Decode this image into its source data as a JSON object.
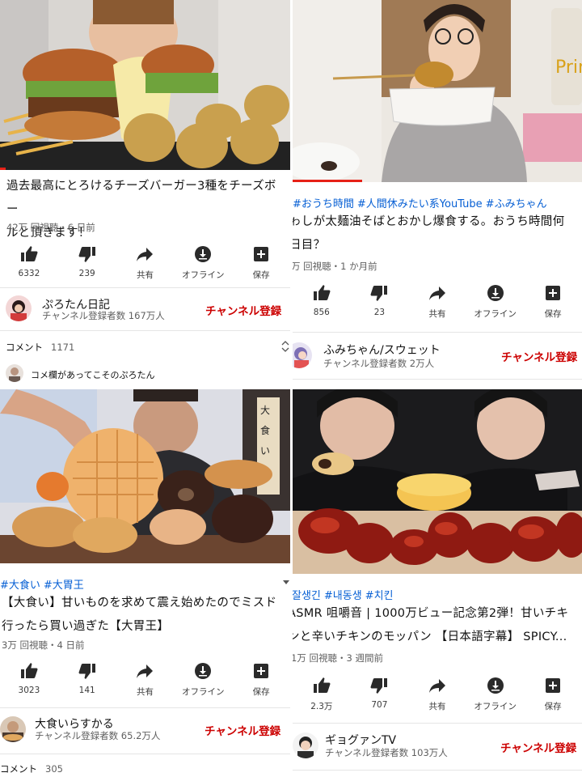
{
  "colors": {
    "accent_red": "#cc0000",
    "link_blue": "#065fd4",
    "progress_red": "#e62117"
  },
  "icons": {
    "like": "thumbs-up-icon",
    "dislike": "thumbs-down-icon",
    "share": "share-arrow-icon",
    "offline": "download-circle-icon",
    "save": "playlist-add-icon"
  },
  "videos": [
    {
      "id_label": "top-left",
      "tags": [],
      "title_lines": [
        "過去最高にとろけるチーズバーガー3種をチーズボー",
        "ルと頂きます！"
      ],
      "meta": "42万 回視聴・6 日前",
      "actions": [
        {
          "label": "6332"
        },
        {
          "label": "239"
        },
        {
          "label": "共有"
        },
        {
          "label": "オフライン"
        },
        {
          "label": "保存"
        }
      ],
      "channel": {
        "name": "ぷろたん日記",
        "subs": "チャンネル登録者数 167万人",
        "subscribe": "チャンネル登録"
      },
      "comments": {
        "label": "コメント",
        "count": "1171",
        "top_comment": "コメ欄があってこそのぷろたん"
      }
    },
    {
      "id_label": "top-right",
      "tags": [
        "#おうち時間",
        "#人間休みたい系YouTube",
        "#ふみちゃん"
      ],
      "title_lines": [
        "ゎしが太麺油そばとおかし爆食する。おうち時間何",
        "日目？"
      ],
      "meta": "万 回視聴・1 か月前",
      "actions": [
        {
          "label": "856"
        },
        {
          "label": "23"
        },
        {
          "label": "共有"
        },
        {
          "label": "オフライン"
        },
        {
          "label": "保存"
        }
      ],
      "channel": {
        "name": "ふみちゃん/スウェット",
        "subs": "チャンネル登録者数 2万人",
        "subscribe": "チャンネル登録"
      }
    },
    {
      "id_label": "bottom-left",
      "tags": [
        "#大食い",
        "#大胃王"
      ],
      "title_lines": [
        "【大食い】甘いものを求めて震え始めたのでミスド",
        "行ったら買い過ぎた【大胃王】"
      ],
      "meta": "3万 回視聴・4 日前",
      "actions": [
        {
          "label": "3023"
        },
        {
          "label": "141"
        },
        {
          "label": "共有"
        },
        {
          "label": "オフライン"
        },
        {
          "label": "保存"
        }
      ],
      "channel": {
        "name": "大食いらすかる",
        "subs": "チャンネル登録者数 65.2万人",
        "subscribe": "チャンネル登録"
      },
      "comments": {
        "label": "コメント",
        "count": "305"
      }
    },
    {
      "id_label": "bottom-right",
      "tags": [
        "잘생긴",
        "#내동생",
        "#치킨"
      ],
      "title_lines": [
        "ASMR 咀嚼音 | 1000万ビュー記念第2弾！甘いチキ",
        "ンと辛いチキンのモッパン 【日本語字幕】 SPICY..."
      ],
      "meta": "1万 回視聴・3 週間前",
      "actions": [
        {
          "label": "2.3万"
        },
        {
          "label": "707"
        },
        {
          "label": "共有"
        },
        {
          "label": "オフライン"
        },
        {
          "label": "保存"
        }
      ],
      "channel": {
        "name": "ギョグァンTV",
        "subs": "チャンネル登録者数 103万人",
        "subscribe": "チャンネル登録"
      }
    }
  ]
}
